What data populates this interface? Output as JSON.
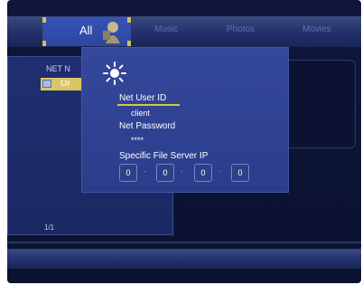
{
  "tabs": [
    {
      "label": "All"
    },
    {
      "label": "Music"
    },
    {
      "label": "Photos"
    },
    {
      "label": "Movies"
    }
  ],
  "browser": {
    "header": "NET  N",
    "selected_item": "Ur",
    "page_indicator": "1/1"
  },
  "dialog": {
    "icon": "gear-sun-icon",
    "user_id_label": "Net User ID",
    "user_id_value": "client",
    "password_label": "Net Password",
    "password_value": "****",
    "server_ip_label": "Specific File Server IP",
    "server_ip": [
      "0",
      "0",
      "0",
      "0"
    ]
  },
  "colors": {
    "accent": "#d9c73a",
    "dialog_bg": "#34489c",
    "panel_bg": "#0f1639",
    "tab_active": "#3553b6"
  }
}
